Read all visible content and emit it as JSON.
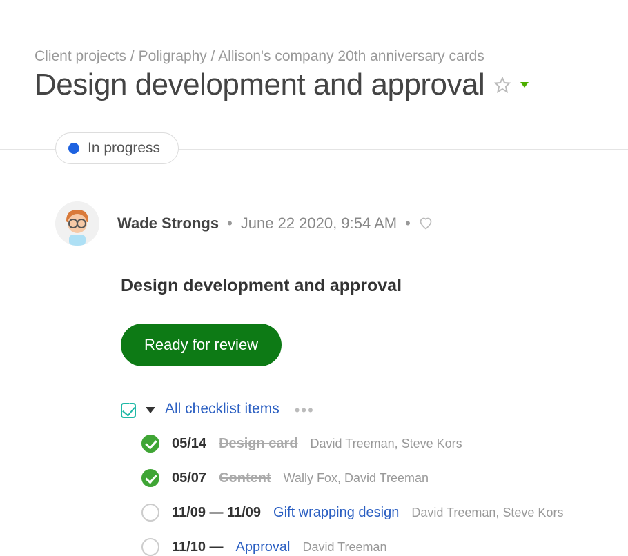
{
  "breadcrumb": {
    "a": "Client projects",
    "b": "Poligraphy",
    "c": "Allison's company 20th anniversary cards"
  },
  "page_title": "Design development and approval",
  "status": {
    "label": "In progress"
  },
  "author": {
    "name": "Wade Strongs",
    "timestamp": "June 22 2020, 9:54 AM"
  },
  "content_title": "Design development and approval",
  "review_button_label": "Ready for review",
  "checklist": {
    "header_link": "All checklist items",
    "items": [
      {
        "date": "05/14",
        "title": "Design card",
        "assignees": "David Treeman, Steve Kors",
        "done": true
      },
      {
        "date": "05/07",
        "title": "Content",
        "assignees": "Wally Fox, David Treeman",
        "done": true
      },
      {
        "date": "11/09 — 11/09",
        "title": "Gift wrapping design",
        "assignees": "David Treeman, Steve Kors",
        "done": false
      },
      {
        "date": "11/10 —",
        "title": "Approval",
        "assignees": "David Treeman",
        "done": false
      }
    ]
  }
}
